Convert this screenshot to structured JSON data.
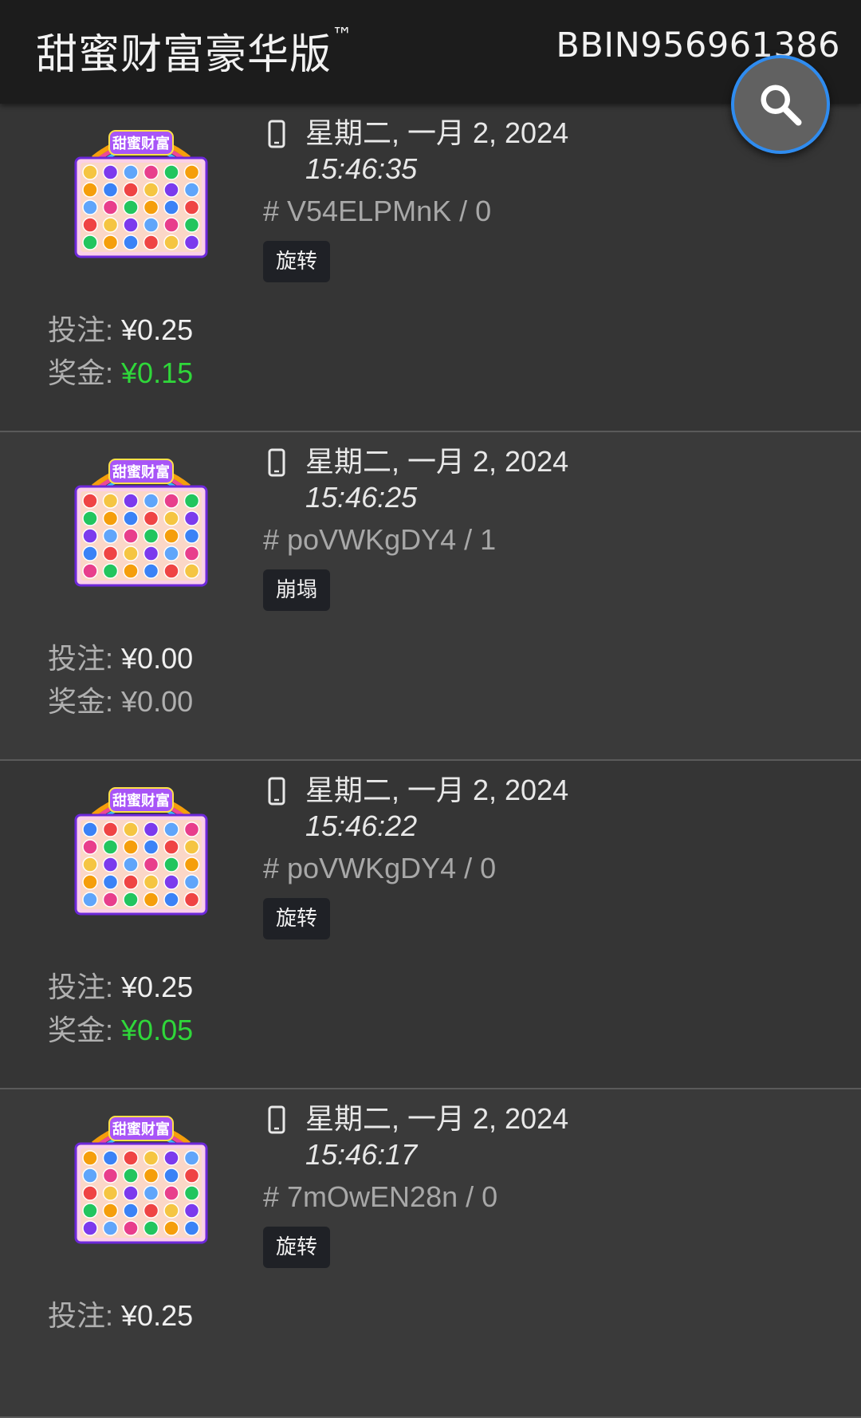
{
  "header": {
    "title": "甜蜜财富豪华版",
    "trademark": "™",
    "account_id": "BBIN956961386"
  },
  "search_button": {
    "icon": "search-icon"
  },
  "colors": {
    "win_positive": "#2fd73a",
    "fab_border": "#2f8cf0"
  },
  "records": [
    {
      "date": "星期二, 一月 2, 2024",
      "time": "15:46:35",
      "round_id": "# V54ELPMnK / 0",
      "tag": "旋转",
      "bet_label": "投注:",
      "bet_amount": "¥0.25",
      "win_label": "奖金:",
      "win_amount": "¥0.15"
    },
    {
      "date": "星期二, 一月 2, 2024",
      "time": "15:46:25",
      "round_id": "# poVWKgDY4 / 1",
      "tag": "崩塌",
      "bet_label": "投注:",
      "bet_amount": "¥0.00",
      "win_label": "奖金:",
      "win_amount": "¥0.00"
    },
    {
      "date": "星期二, 一月 2, 2024",
      "time": "15:46:22",
      "round_id": "# poVWKgDY4 / 0",
      "tag": "旋转",
      "bet_label": "投注:",
      "bet_amount": "¥0.25",
      "win_label": "奖金:",
      "win_amount": "¥0.05"
    },
    {
      "date": "星期二, 一月 2, 2024",
      "time": "15:46:17",
      "round_id": "# 7mOwEN28n / 0",
      "tag": "旋转",
      "bet_label": "投注:",
      "bet_amount": "¥0.25"
    }
  ],
  "thumbnail": {
    "logo_text": "甜蜜财富",
    "icon": "game-thumbnail-icon"
  },
  "device_icon": "mobile-phone-icon"
}
